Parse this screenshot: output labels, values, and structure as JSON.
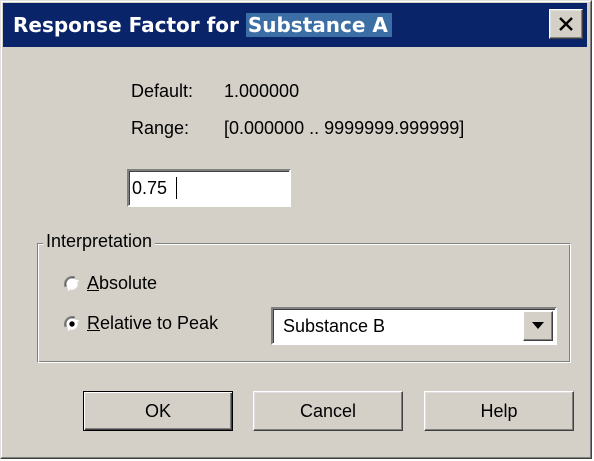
{
  "window": {
    "title_prefix": "Response Factor for ",
    "title_highlight": "Substance A"
  },
  "info": {
    "default_label": "Default:",
    "default_value": "1.000000",
    "range_label": "Range:",
    "range_value": "[0.000000 .. 9999999.999999]"
  },
  "input": {
    "value": "0.75"
  },
  "interpretation": {
    "legend": "Interpretation",
    "absolute": {
      "mnemonic": "A",
      "rest": "bsolute",
      "selected": false
    },
    "relative": {
      "mnemonic": "R",
      "rest": "elative to Peak",
      "selected": true
    },
    "peak_select": {
      "value": "Substance B"
    }
  },
  "buttons": {
    "ok": "OK",
    "cancel": "Cancel",
    "help": "Help"
  },
  "colors": {
    "title_bg": "#0a246a",
    "title_highlight": "#3a6ea5",
    "face": "#d4d0c8"
  }
}
